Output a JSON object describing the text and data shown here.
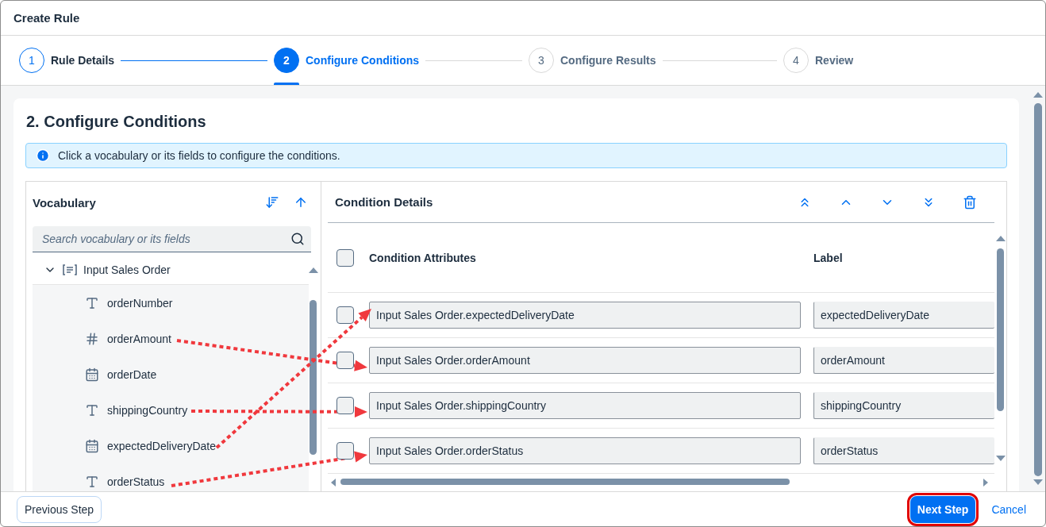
{
  "dialog": {
    "title": "Create Rule"
  },
  "steps": [
    {
      "number": "1",
      "label": "Rule Details",
      "completed": true,
      "selected": false
    },
    {
      "number": "2",
      "label": "Configure Conditions",
      "completed": false,
      "selected": true
    },
    {
      "number": "3",
      "label": "Configure Results",
      "completed": false,
      "selected": false
    },
    {
      "number": "4",
      "label": "Review",
      "completed": false,
      "selected": false
    }
  ],
  "section": {
    "title": "2. Configure Conditions",
    "info": "Click a vocabulary or its fields to configure the conditions."
  },
  "vocabulary": {
    "title": "Vocabulary",
    "search": {
      "placeholder": "Search vocabulary or its fields"
    },
    "tree": [
      {
        "label": "Input Sales Order",
        "expanded": true,
        "children": [
          {
            "label": "orderNumber",
            "kind": "text"
          },
          {
            "label": "orderAmount",
            "kind": "number"
          },
          {
            "label": "orderDate",
            "kind": "date"
          },
          {
            "label": "shippingCountry",
            "kind": "text"
          },
          {
            "label": "expectedDeliveryDate",
            "kind": "date"
          },
          {
            "label": "orderStatus",
            "kind": "text"
          }
        ]
      }
    ]
  },
  "conditions": {
    "title": "Condition Details",
    "columns": [
      "Condition Attributes",
      "Label"
    ],
    "all_checked": false,
    "rows": [
      {
        "checked": false,
        "attribute": "Input Sales Order.expectedDeliveryDate",
        "label": "expectedDeliveryDate"
      },
      {
        "checked": false,
        "attribute": "Input Sales Order.orderAmount",
        "label": "orderAmount"
      },
      {
        "checked": false,
        "attribute": "Input Sales Order.shippingCountry",
        "label": "shippingCountry"
      },
      {
        "checked": false,
        "attribute": "Input Sales Order.orderStatus",
        "label": "orderStatus"
      }
    ]
  },
  "footer": {
    "buttons": [
      {
        "label": "Previous Step",
        "kind": "secondary",
        "highlighted": false
      },
      {
        "label": "Next Step",
        "kind": "primary",
        "highlighted": true
      },
      {
        "label": "Cancel",
        "kind": "link",
        "highlighted": false
      }
    ]
  }
}
